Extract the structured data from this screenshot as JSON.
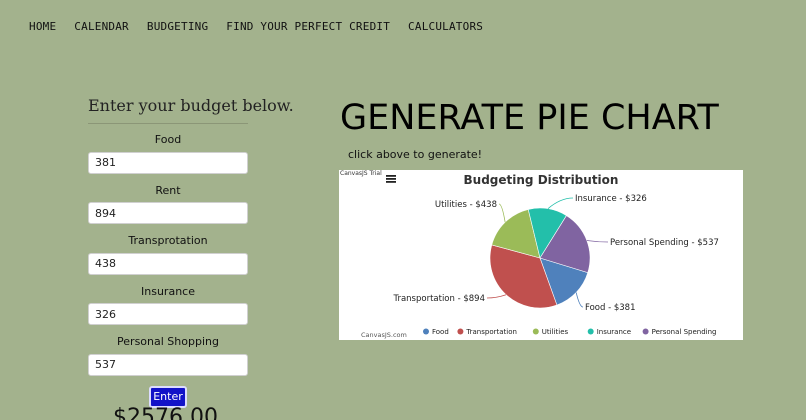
{
  "nav": {
    "items": [
      "HOME",
      "CALENDAR",
      "BUDGETING",
      "FIND YOUR PERFECT CREDIT",
      "CALCULATORS"
    ]
  },
  "form": {
    "title": "Enter your budget below.",
    "fields": [
      {
        "label": "Food",
        "value": "381"
      },
      {
        "label": "Rent",
        "value": "894"
      },
      {
        "label": "Transprotation",
        "value": "438"
      },
      {
        "label": "Insurance",
        "value": "326"
      },
      {
        "label": "Personal Shopping",
        "value": "537"
      }
    ],
    "enter_label": "Enter",
    "total": "$2576.00"
  },
  "main": {
    "heading": "GENERATE PIE CHART",
    "hint": "click above to generate!"
  },
  "chart_data": {
    "type": "pie",
    "title": "Budgeting Distribution",
    "trial_text": "CanvasJS Trial",
    "credit": "CanvasJS.com",
    "menu_icon": "hamburger-menu-icon",
    "legend_position": "bottom",
    "slices": [
      {
        "name": "Food",
        "value": 381,
        "label": "Food - $381",
        "color": "#4f81bc"
      },
      {
        "name": "Transportation",
        "value": 894,
        "label": "Transportation - $894",
        "color": "#c0504e"
      },
      {
        "name": "Utilities",
        "value": 438,
        "label": "Utilities - $438",
        "color": "#9bbb58"
      },
      {
        "name": "Insurance",
        "value": 326,
        "label": "Insurance - $326",
        "color": "#23bfaa"
      },
      {
        "name": "Personal Spending",
        "value": 537,
        "label": "Personal Spending - $537",
        "color": "#8064a1"
      }
    ]
  }
}
